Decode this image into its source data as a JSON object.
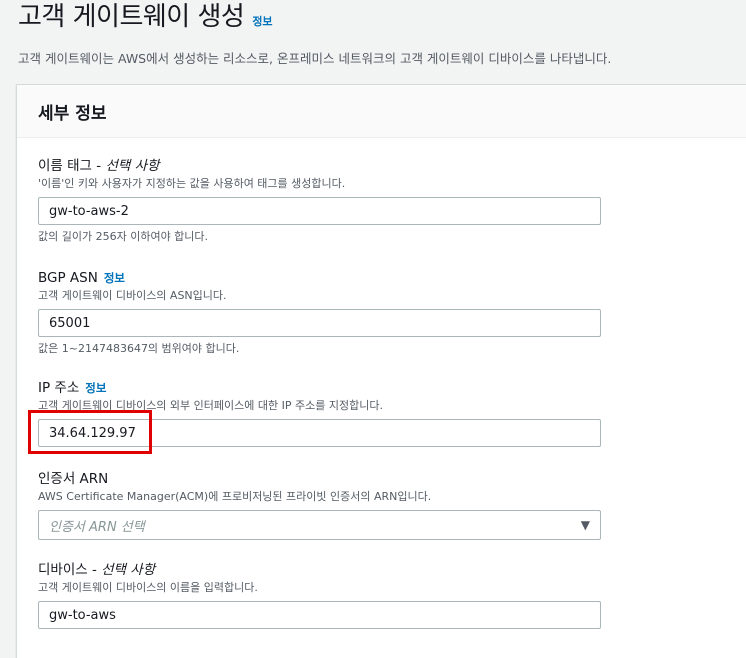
{
  "header": {
    "title": "고객 게이트웨이 생성",
    "info": "정보",
    "description": "고객 게이트웨이는 AWS에서 생성하는 리소스로, 온프레미스 네트워크의 고객 게이트웨이 디바이스를 나타냅니다."
  },
  "panel": {
    "title": "세부 정보"
  },
  "fields": {
    "name_tag": {
      "label": "이름 태그 - ",
      "optional": "선택 사항",
      "description": "'이름'인 키와 사용자가 지정하는 값을 사용하여 태그를 생성합니다.",
      "value": "gw-to-aws-2",
      "constraint": "값의 길이가 256자 이하여야 합니다."
    },
    "bgp_asn": {
      "label": "BGP ASN",
      "info": "정보",
      "description": "고객 게이트웨이 디바이스의 ASN입니다.",
      "value": "65001",
      "constraint": "값은 1~2147483647의 범위여야 합니다."
    },
    "ip_address": {
      "label": "IP 주소",
      "info": "정보",
      "description": "고객 게이트웨이 디바이스의 외부 인터페이스에 대한 IP 주소를 지정합니다.",
      "value": "34.64.129.97"
    },
    "certificate_arn": {
      "label": "인증서 ARN",
      "description": "AWS Certificate Manager(ACM)에 프로비저닝된 프라이빗 인증서의 ARN입니다.",
      "placeholder": "인증서 ARN 선택"
    },
    "device": {
      "label": "디바이스 - ",
      "optional": "선택 사항",
      "description": "고객 게이트웨이 디바이스의 이름을 입력합니다.",
      "value": "gw-to-aws"
    }
  },
  "colors": {
    "link": "#0073bb",
    "highlight": "#e10000"
  }
}
